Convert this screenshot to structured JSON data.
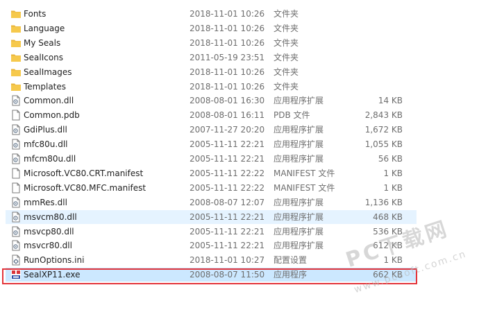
{
  "files": [
    {
      "name": "Fonts",
      "date": "2018-11-01 10:26",
      "type": "文件夹",
      "size": "",
      "icon": "folder-icon"
    },
    {
      "name": "Language",
      "date": "2018-11-01 10:26",
      "type": "文件夹",
      "size": "",
      "icon": "folder-icon"
    },
    {
      "name": "My Seals",
      "date": "2018-11-01 10:26",
      "type": "文件夹",
      "size": "",
      "icon": "folder-icon"
    },
    {
      "name": "SealIcons",
      "date": "2011-05-19 23:51",
      "type": "文件夹",
      "size": "",
      "icon": "folder-icon"
    },
    {
      "name": "SealImages",
      "date": "2018-11-01 10:26",
      "type": "文件夹",
      "size": "",
      "icon": "folder-icon"
    },
    {
      "name": "Templates",
      "date": "2018-11-01 10:26",
      "type": "文件夹",
      "size": "",
      "icon": "folder-icon"
    },
    {
      "name": "Common.dll",
      "date": "2008-08-01 16:30",
      "type": "应用程序扩展",
      "size": "14 KB",
      "icon": "dll-icon"
    },
    {
      "name": "Common.pdb",
      "date": "2008-08-01 16:11",
      "type": "PDB 文件",
      "size": "2,843 KB",
      "icon": "file-icon"
    },
    {
      "name": "GdiPlus.dll",
      "date": "2007-11-27 20:20",
      "type": "应用程序扩展",
      "size": "1,672 KB",
      "icon": "dll-icon"
    },
    {
      "name": "mfc80u.dll",
      "date": "2005-11-11 22:21",
      "type": "应用程序扩展",
      "size": "1,055 KB",
      "icon": "dll-icon"
    },
    {
      "name": "mfcm80u.dll",
      "date": "2005-11-11 22:21",
      "type": "应用程序扩展",
      "size": "56 KB",
      "icon": "dll-icon"
    },
    {
      "name": "Microsoft.VC80.CRT.manifest",
      "date": "2005-11-11 22:22",
      "type": "MANIFEST 文件",
      "size": "1 KB",
      "icon": "file-icon"
    },
    {
      "name": "Microsoft.VC80.MFC.manifest",
      "date": "2005-11-11 22:22",
      "type": "MANIFEST 文件",
      "size": "1 KB",
      "icon": "file-icon"
    },
    {
      "name": "mmRes.dll",
      "date": "2008-08-07 12:07",
      "type": "应用程序扩展",
      "size": "1,136 KB",
      "icon": "dll-icon"
    },
    {
      "name": "msvcm80.dll",
      "date": "2005-11-11 22:21",
      "type": "应用程序扩展",
      "size": "468 KB",
      "icon": "dll-icon"
    },
    {
      "name": "msvcp80.dll",
      "date": "2005-11-11 22:21",
      "type": "应用程序扩展",
      "size": "536 KB",
      "icon": "dll-icon"
    },
    {
      "name": "msvcr80.dll",
      "date": "2005-11-11 22:21",
      "type": "应用程序扩展",
      "size": "612 KB",
      "icon": "dll-icon"
    },
    {
      "name": "RunOptions.ini",
      "date": "2018-11-01 10:27",
      "type": "配置设置",
      "size": "1 KB",
      "icon": "settings-file-icon"
    },
    {
      "name": "SealXP11.exe",
      "date": "2008-08-07 11:50",
      "type": "应用程序",
      "size": "662 KB",
      "icon": "app-icon"
    }
  ],
  "hover_row": 14,
  "selected_row": 18,
  "colors": {
    "selected": "#cce8ff",
    "hover": "#e5f3ff",
    "highlight_box": "#e3343a",
    "folder": "#f6c94c"
  },
  "watermark": {
    "main": "PC下载网",
    "url": "www.pcsoft.com.cn"
  }
}
